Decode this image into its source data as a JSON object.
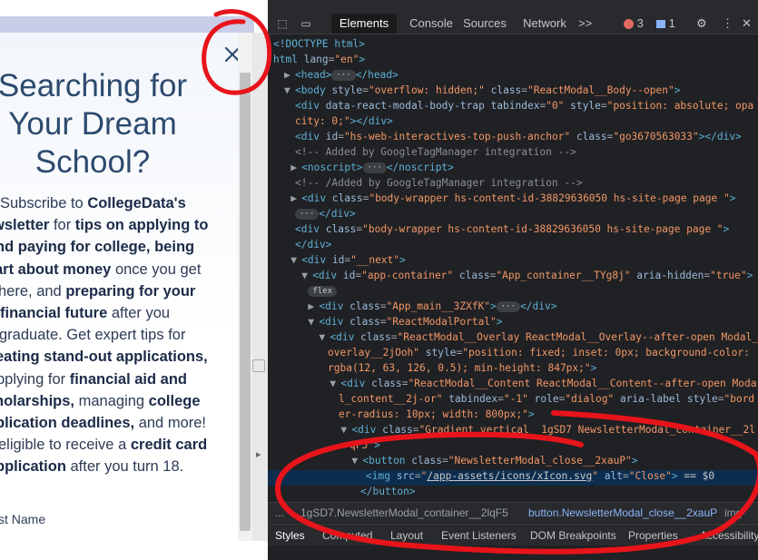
{
  "page": {
    "headline": [
      "Searching for",
      "Your Dream",
      "School?"
    ],
    "body_lines": [
      [
        {
          "t": "Subscribe to "
        },
        {
          "b": "CollegeData's"
        }
      ],
      [
        {
          "b": "wsletter"
        },
        {
          "t": " for "
        },
        {
          "b": "tips on applying to"
        }
      ],
      [
        {
          "b": "nd paying for college, being"
        }
      ],
      [
        {
          "b": "art about money"
        },
        {
          "t": " once you get"
        }
      ],
      [
        {
          "t": "here, and "
        },
        {
          "b": "preparing for your"
        }
      ],
      [
        {
          "b": " financial future"
        },
        {
          "t": " after you"
        }
      ],
      [
        {
          "t": "graduate. Get expert tips for"
        }
      ],
      [
        {
          "b": "eating stand-out applications,"
        }
      ],
      [
        {
          "t": "pplying for "
        },
        {
          "b": "financial aid and"
        }
      ],
      [
        {
          "b": "holarships,"
        },
        {
          "t": " managing "
        },
        {
          "b": "college"
        }
      ],
      [
        {
          "b": "plication deadlines,"
        },
        {
          "t": " and more!"
        }
      ],
      [
        {
          "t": "eligible to receive a "
        },
        {
          "b": "credit card"
        }
      ],
      [
        {
          "b": "pplication"
        },
        {
          "t": " after you turn 18."
        }
      ]
    ],
    "first_name_label": "st Name",
    "close_icon": "close-x-icon"
  },
  "devtools": {
    "tabs": [
      "Elements",
      "Console",
      "Sources",
      "Network"
    ],
    "more": ">>",
    "errors_count": "3",
    "messages_count": "1",
    "dom_lines": [
      {
        "ind": 0,
        "tri": "",
        "html": "<span class='tag'>&lt;!DOCTYPE html&gt;</span>"
      },
      {
        "ind": 0,
        "tri": "",
        "html": "<span class='tag'>html</span> <span class='attr'>lang</span>=<span class='val'>\"en\"</span><span class='tag'>&gt;</span>"
      },
      {
        "ind": 1,
        "tri": "▶",
        "html": "<span class='tag'>&lt;head&gt;</span><span class='pill'>···</span><span class='tag'>&lt;/head&gt;</span>"
      },
      {
        "ind": 1,
        "tri": "▼",
        "html": "<span class='tag'>&lt;body</span> <span class='attr'>style</span>=<span class='val'>\"overflow: hidden;\"</span> <span class='attr'>class</span>=<span class='val'>\"ReactModal__Body--open\"</span><span class='tag'>&gt;</span>"
      },
      {
        "ind": 2,
        "tri": "",
        "html": "<span class='tag'>&lt;div</span> <span class='attr'>data-react-modal-body-trap tabindex</span>=<span class='val'>\"0\"</span> <span class='attr'>style</span>=<span class='val'>\"position: absolute; opa</span>"
      },
      {
        "ind": 2,
        "tri": "",
        "html": "<span class='val'>city: 0;\"</span><span class='tag'>&gt;&lt;/div&gt;</span>"
      },
      {
        "ind": 2,
        "tri": "",
        "html": "<span class='tag'>&lt;div</span> <span class='attr'>id</span>=<span class='val'>\"hs-web-interactives-top-push-anchor\"</span> <span class='attr'>class</span>=<span class='val'>\"go3670563033\"</span><span class='tag'>&gt;&lt;/div&gt;</span>"
      },
      {
        "ind": 2,
        "tri": "",
        "html": "<span class='cmt'>&lt;!--  Added by GoogleTagManager integration --&gt;</span>"
      },
      {
        "ind": 1.6,
        "tri": "▶",
        "html": "<span class='tag'>&lt;noscript&gt;</span><span class='pill'>···</span><span class='tag'>&lt;/noscript&gt;</span>"
      },
      {
        "ind": 2,
        "tri": "",
        "html": "<span class='cmt'>&lt;!-- /Added by GoogleTagManager integration --&gt;</span>"
      },
      {
        "ind": 1.6,
        "tri": "▶",
        "html": "<span class='tag'>&lt;div</span> <span class='attr'>class</span>=<span class='val'>\"body-wrapper   hs-content-id-38829636050 hs-site-page page \"</span><span class='tag'>&gt;</span>"
      },
      {
        "ind": 2,
        "tri": "",
        "html": "<span class='pill'>···</span><span class='tag'>&lt;/div&gt;</span>"
      },
      {
        "ind": 2,
        "tri": "",
        "html": "<span class='tag'>&lt;div</span> <span class='attr'>class</span>=<span class='val'>\"body-wrapper   hs-content-id-38829636050 hs-site-page page \"</span><span class='tag'>&gt;</span>"
      },
      {
        "ind": 2,
        "tri": "",
        "html": "<span class='tag'>&lt;/div&gt;</span>"
      },
      {
        "ind": 1.6,
        "tri": "▼",
        "html": "<span class='tag'>&lt;div</span> <span class='attr'>id</span>=<span class='val'>\"__next\"</span><span class='tag'>&gt;</span>"
      },
      {
        "ind": 2.6,
        "tri": "▼",
        "html": "<span class='tag'>&lt;div</span> <span class='attr'>id</span>=<span class='val'>\"app-container\"</span> <span class='attr'>class</span>=<span class='val'>\"App_container__TYg8j\"</span> <span class='attr'>aria-hidden</span>=<span class='val'>\"true\"</span><span class='tag'>&gt;</span>"
      },
      {
        "ind": 3.2,
        "tri": "",
        "html": "<span class='pill'>flex</span>"
      },
      {
        "ind": 3.2,
        "tri": "▶",
        "html": "<span class='tag'>&lt;div</span> <span class='attr'>class</span>=<span class='val'>\"App_main__3ZXfK\"</span><span class='tag'>&gt;</span><span class='pill'>···</span><span class='tag'>&lt;/div&gt;</span>"
      },
      {
        "ind": 3.2,
        "tri": "▼",
        "html": "<span class='tag'>&lt;div</span> <span class='attr'>class</span>=<span class='val'>\"ReactModalPortal\"</span><span class='tag'>&gt;</span>"
      },
      {
        "ind": 4.2,
        "tri": "▼",
        "html": "<span class='tag'>&lt;div</span> <span class='attr'>class</span>=<span class='val'>\"ReactModal__Overlay ReactModal__Overlay--after-open Modal_</span>"
      },
      {
        "ind": 5,
        "tri": "",
        "html": "<span class='val'>overlay__2jOoh\"</span> <span class='attr'>style</span>=<span class='val'>\"position: fixed; inset: 0px; background-color:</span>"
      },
      {
        "ind": 5,
        "tri": "",
        "html": "<span class='val'>rgba(12, 63, 126, 0.5); min-height: 847px;\"</span><span class='tag'>&gt;</span>"
      },
      {
        "ind": 5.2,
        "tri": "▼",
        "html": "<span class='tag'>&lt;div</span> <span class='attr'>class</span>=<span class='val'>\"ReactModal__Content ReactModal__Content--after-open Moda</span>"
      },
      {
        "ind": 6,
        "tri": "",
        "html": "<span class='val'>l_content__2j-or\"</span> <span class='attr'>tabindex</span>=<span class='val'>\"-1\"</span> <span class='attr'>role</span>=<span class='val'>\"dialog\"</span> <span class='attr'>aria-label style</span>=<span class='val'>\"bord</span>"
      },
      {
        "ind": 6,
        "tri": "",
        "html": "<span class='val'>er-radius: 10px; width: 800px;\"</span><span class='tag'>&gt;</span>"
      },
      {
        "ind": 6.2,
        "tri": "▼",
        "html": "<span class='tag'>&lt;div</span> <span class='attr'>class</span>=<span class='val'>\"Gradient_vertical__1gSD7 NewsletterModal_container__2l</span>"
      },
      {
        "ind": 7,
        "tri": "",
        "html": "<span class='val'>qF5\"</span><span class='tag'>&gt;</span>"
      },
      {
        "ind": 7.2,
        "tri": "▼",
        "html": "<span class='tag'>&lt;button</span> <span class='attr'>class</span>=<span class='val'>\"NewsletterModal_close__2xauP\"</span><span class='tag'>&gt;</span>"
      },
      {
        "ind": 8.5,
        "tri": "",
        "html": "<span class='tag'>&lt;img</span> <span class='attr'>src</span>=<span class='val'>\"</span><span class='link'>/app-assets/icons/xIcon.svg</span><span class='val'>\"</span> <span class='attr'>alt</span>=<span class='val'>\"Close\"</span><span class='tag'>&gt;</span> <span class='txt'>== $0</span>"
      },
      {
        "ind": 8,
        "tri": "",
        "html": "<span class='tag'>&lt;/button&gt;</span>"
      }
    ],
    "breadcrumbs": [
      "...",
      "1gSD7.NewsletterModal_container__2lqF5",
      "button.NewsletterModal_close__2xauP",
      "img"
    ],
    "bottom_tabs": [
      "Styles",
      "Computed",
      "Layout",
      "Event Listeners",
      "DOM Breakpoints",
      "Properties",
      "Accessibility"
    ]
  }
}
